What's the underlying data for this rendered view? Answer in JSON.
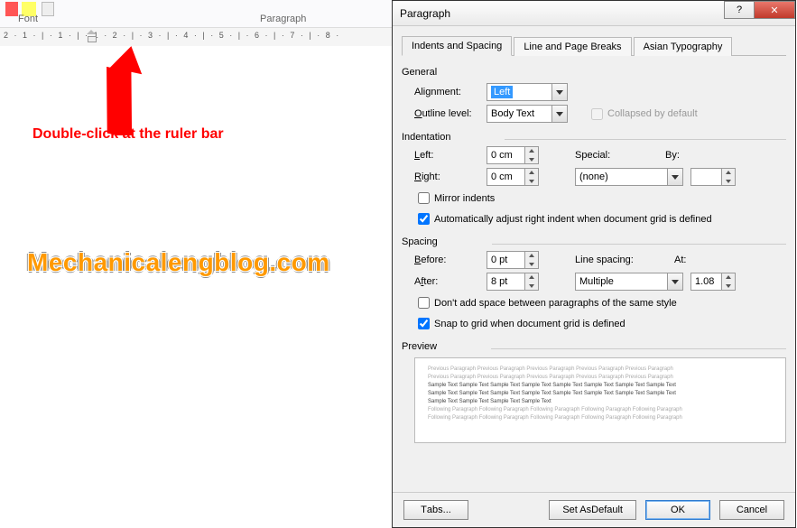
{
  "ribbon": {
    "font_label": "Font",
    "paragraph_label": "Paragraph"
  },
  "ruler_text": "2 · 1 · | · 1 · | · 1 · 2 · | · 3 · | · 4 · | · 5 · | · 6 · | · 7 · | · 8 ·",
  "callout": "Double-click at the ruler bar",
  "watermark": "Mechanicalengblog.com",
  "dialog": {
    "title": "Paragraph",
    "tabs": [
      "Indents and Spacing",
      "Line and Page Breaks",
      "Asian Typography"
    ],
    "active_tab": 0,
    "general": {
      "title": "General",
      "alignment_label": "Alignment:",
      "alignment_value": "Left",
      "outline_label": "Outline level:",
      "outline_value": "Body Text",
      "collapsed_label": "Collapsed by default"
    },
    "indentation": {
      "title": "Indentation",
      "left_label": "Left:",
      "left_value": "0 cm",
      "right_label": "Right:",
      "right_value": "0 cm",
      "special_label": "Special:",
      "special_value": "(none)",
      "by_label": "By:",
      "by_value": "",
      "mirror_label": "Mirror indents",
      "auto_right_label": "Automatically adjust right indent when document grid is defined"
    },
    "spacing": {
      "title": "Spacing",
      "before_label": "Before:",
      "before_value": "0 pt",
      "after_label": "After:",
      "after_value": "8 pt",
      "line_spacing_label": "Line spacing:",
      "line_spacing_value": "Multiple",
      "at_label": "At:",
      "at_value": "1.08",
      "dont_add_label": "Don't add space between paragraphs of the same style",
      "snap_label": "Snap to grid when document grid is defined"
    },
    "preview": {
      "title": "Preview",
      "prev_line": "Previous Paragraph Previous Paragraph Previous Paragraph Previous Paragraph Previous Paragraph",
      "sample_line": "Sample Text Sample Text Sample Text Sample Text Sample Text Sample Text Sample Text Sample Text",
      "sample_short": "Sample Text Sample Text Sample Text Sample Text",
      "follow_line": "Following Paragraph Following Paragraph Following Paragraph Following Paragraph Following Paragraph"
    },
    "buttons": {
      "tabs": "Tabs...",
      "default": "Set As Default",
      "ok": "OK",
      "cancel": "Cancel"
    }
  }
}
